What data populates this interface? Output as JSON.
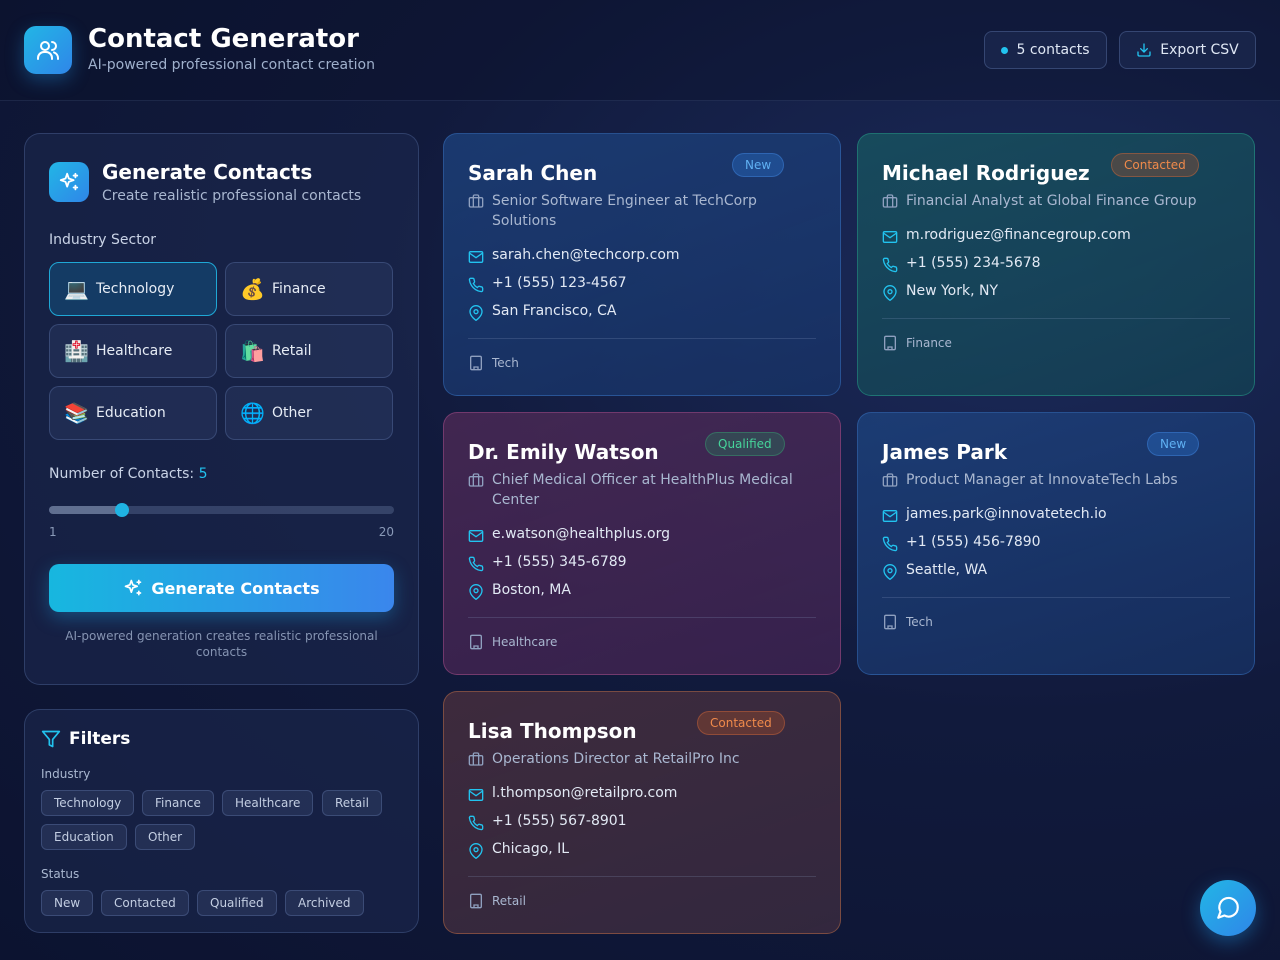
{
  "header": {
    "title": "Contact Generator",
    "subtitle": "AI-powered professional contact creation",
    "count_label": "5 contacts",
    "export_label": "Export CSV"
  },
  "generator": {
    "title": "Generate Contacts",
    "subtitle": "Create realistic professional contacts",
    "industry_label": "Industry Sector",
    "industries": [
      {
        "label": "Technology",
        "emoji": "💻",
        "selected": true
      },
      {
        "label": "Finance",
        "emoji": "💰",
        "selected": false
      },
      {
        "label": "Healthcare",
        "emoji": "🏥",
        "selected": false
      },
      {
        "label": "Retail",
        "emoji": "🛍️",
        "selected": false
      },
      {
        "label": "Education",
        "emoji": "📚",
        "selected": false
      },
      {
        "label": "Other",
        "emoji": "🌐",
        "selected": false
      }
    ],
    "count_label": "Number of Contacts:",
    "count_value": "5",
    "slider_min": "1",
    "slider_max": "20",
    "slider_value": 5,
    "button_label": "Generate Contacts",
    "note": "AI-powered generation creates realistic professional contacts"
  },
  "filters": {
    "title": "Filters",
    "industry_label": "Industry",
    "industry_chips": [
      "Technology",
      "Finance",
      "Healthcare",
      "Retail",
      "Education",
      "Other"
    ],
    "status_label": "Status",
    "status_chips": [
      "New",
      "Contacted",
      "Qualified",
      "Archived"
    ]
  },
  "contacts": [
    {
      "name": "Sarah Chen",
      "status": "New",
      "title": "Senior Software Engineer at TechCorp Solutions",
      "email": "sarah.chen@techcorp.com",
      "phone": "+1 (555) 123-4567",
      "location": "San Francisco, CA",
      "industry": "Tech"
    },
    {
      "name": "Michael Rodriguez",
      "status": "Contacted",
      "title": "Financial Analyst at Global Finance Group",
      "email": "m.rodriguez@financegroup.com",
      "phone": "+1 (555) 234-5678",
      "location": "New York, NY",
      "industry": "Finance"
    },
    {
      "name": "Dr. Emily Watson",
      "status": "Qualified",
      "title": "Chief Medical Officer at HealthPlus Medical Center",
      "email": "e.watson@healthplus.org",
      "phone": "+1 (555) 345-6789",
      "location": "Boston, MA",
      "industry": "Healthcare"
    },
    {
      "name": "James Park",
      "status": "New",
      "title": "Product Manager at InnovateTech Labs",
      "email": "james.park@innovatetech.io",
      "phone": "+1 (555) 456-7890",
      "location": "Seattle, WA",
      "industry": "Tech"
    },
    {
      "name": "Lisa Thompson",
      "status": "Contacted",
      "title": "Operations Director at RetailPro Inc",
      "email": "l.thompson@retailpro.com",
      "phone": "+1 (555) 567-8901",
      "location": "Chicago, IL",
      "industry": "Retail"
    }
  ],
  "colors": {
    "accent": "#22c3ef",
    "primary_gradient_start": "#17b7df",
    "primary_gradient_end": "#3a86ec"
  }
}
